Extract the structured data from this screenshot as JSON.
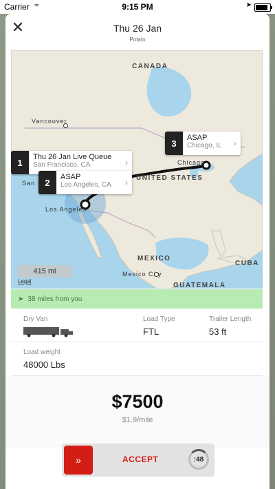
{
  "status_bar": {
    "carrier": "Carrier",
    "time": "9:15 PM"
  },
  "header": {
    "title": "Thu 26 Jan",
    "subtitle": "Potato"
  },
  "map": {
    "labels": {
      "canada": "CANADA",
      "united_states": "UNITED STATES",
      "mexico": "MEXICO",
      "cuba": "CUBA",
      "guatemala": "GUATEMALA",
      "vancouver": "Vancouver",
      "chicago": "Chicago",
      "los_angeles": "Los Angeles",
      "mexico_city": "Mexico City",
      "san_partial": "San"
    },
    "scale": "415 mi",
    "legal": "Legal",
    "route_color": "#111111",
    "water_color": "#a8d4ec",
    "land_color": "#ede9dd"
  },
  "stops": [
    {
      "number": "1",
      "title": "Thu 26 Jan Live Queue",
      "location": "San Francisco, CA"
    },
    {
      "number": "2",
      "title": "ASAP",
      "location": "Los Angeles, CA"
    },
    {
      "number": "3",
      "title": "ASAP",
      "location": "Chicago, IL"
    }
  ],
  "distance": {
    "text": "38 miles from you",
    "icon": "location-arrow-icon"
  },
  "details": {
    "equipment": "Dry Van",
    "load_type_label": "Load Type",
    "load_type_value": "FTL",
    "trailer_length_label": "Trailer Length",
    "trailer_length_value": "53 ft",
    "load_weight_label": "Load weight",
    "load_weight_value": "48000 Lbs"
  },
  "pricing": {
    "price": "$7500",
    "rate": "$1.9/mile"
  },
  "accept": {
    "label": "ACCEPT",
    "arrows": "»",
    "timer": ":48",
    "accent_color": "#d31e16"
  }
}
